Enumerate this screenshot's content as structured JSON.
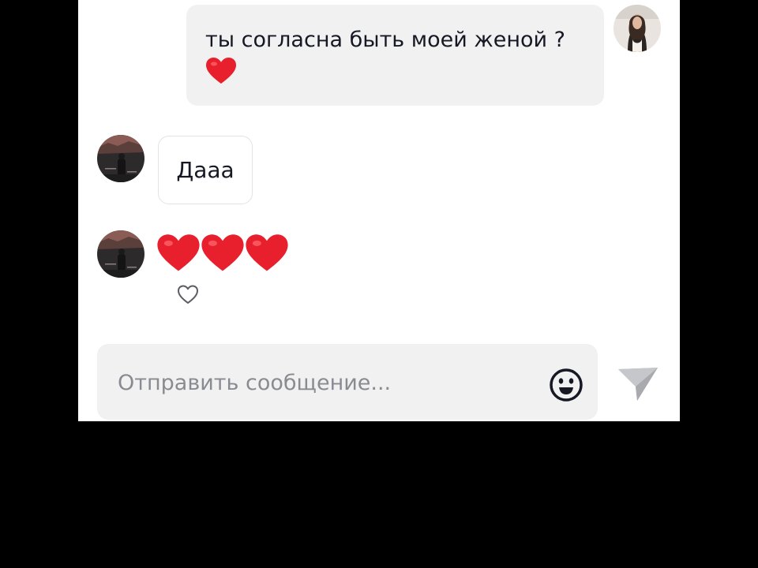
{
  "messages": [
    {
      "direction": "outgoing",
      "text": "ты согласна быть моей женой ?",
      "emoji": "heart"
    },
    {
      "direction": "incoming",
      "text": "Дааа"
    },
    {
      "direction": "incoming",
      "emoji": [
        "heart",
        "heart",
        "heart"
      ]
    }
  ],
  "composer": {
    "placeholder": "Отправить сообщение...",
    "emoji_button_icon": "smiley-icon",
    "send_button_icon": "send-icon"
  },
  "reaction_icon": "heart-outline-icon",
  "colors": {
    "heart": "#e8202e",
    "bubble": "#f1f1f2",
    "text": "#161823",
    "placeholder": "#8a8b91",
    "send_disabled": "#b3b4b8"
  }
}
